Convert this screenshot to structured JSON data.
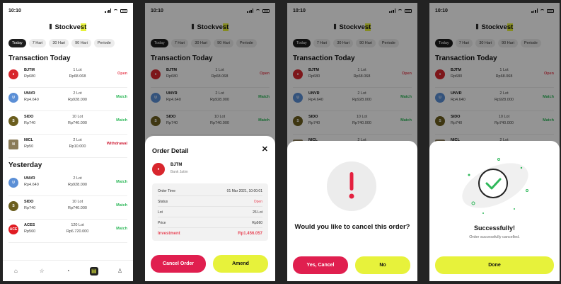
{
  "status": {
    "time": "10:10"
  },
  "brand": {
    "name_prefix": "Stockve",
    "name_highlight": "st"
  },
  "tabs": [
    "Today",
    "7 Hari",
    "30 Hari",
    "90 Hari",
    "Periode"
  ],
  "sections": {
    "today": "Transaction Today",
    "yesterday": "Yesterday"
  },
  "today": [
    {
      "ticker": "BJTM",
      "price": "Rp680",
      "lot": "1 Lot",
      "amount": "Rp68.068",
      "status": "Open",
      "logo": "BJTM"
    },
    {
      "ticker": "UNVR",
      "price": "Rp4.640",
      "lot": "2 Lot",
      "amount": "Rp928.000",
      "status": "Match",
      "logo": "U"
    },
    {
      "ticker": "SIDO",
      "price": "Rp740",
      "lot": "10 Lot",
      "amount": "Rp740.000",
      "status": "Match",
      "logo": "S"
    },
    {
      "ticker": "NICL",
      "price": "Rp50",
      "lot": "2 Lot",
      "amount": "Rp10.000",
      "status": "Withdrawal",
      "logo": "N"
    }
  ],
  "yesterday": [
    {
      "ticker": "UNVR",
      "price": "Rp4.640",
      "lot": "2 Lot",
      "amount": "Rp928.000",
      "status": "Match",
      "logo": "U"
    },
    {
      "ticker": "SIDO",
      "price": "Rp740",
      "lot": "10 Lot",
      "amount": "Rp740.000",
      "status": "Match",
      "logo": "S"
    },
    {
      "ticker": "ACES",
      "price": "Rp560",
      "lot": "120 Lot",
      "amount": "Rp6.720.000",
      "status": "Match",
      "logo": "ACE"
    }
  ],
  "order_detail": {
    "title": "Order Detail",
    "close": "✕",
    "stock_code": "BJTM",
    "stock_name": "Bank Jatim",
    "rows": [
      {
        "label": "Order Time",
        "value": "01 Mar 2021, 10:00:01"
      },
      {
        "label": "Status",
        "value": "Open"
      },
      {
        "label": "Lot",
        "value": "26 Lot"
      },
      {
        "label": "Price",
        "value": "Rp560"
      },
      {
        "label": "Investment",
        "value": "Rp1.456.057"
      }
    ],
    "cancel_label": "Cancel Order",
    "amend_label": "Amend"
  },
  "confirm": {
    "question": "Would you like to cancel this order?",
    "yes_label": "Yes, Cancel",
    "no_label": "No"
  },
  "success": {
    "title": "Successfully!",
    "subtitle": "Order successfully cancelled.",
    "done_label": "Done"
  },
  "colors": {
    "accent": "#e7f23b",
    "danger": "#e01f4f",
    "match": "#2fb85a",
    "open": "#e84a5a"
  }
}
